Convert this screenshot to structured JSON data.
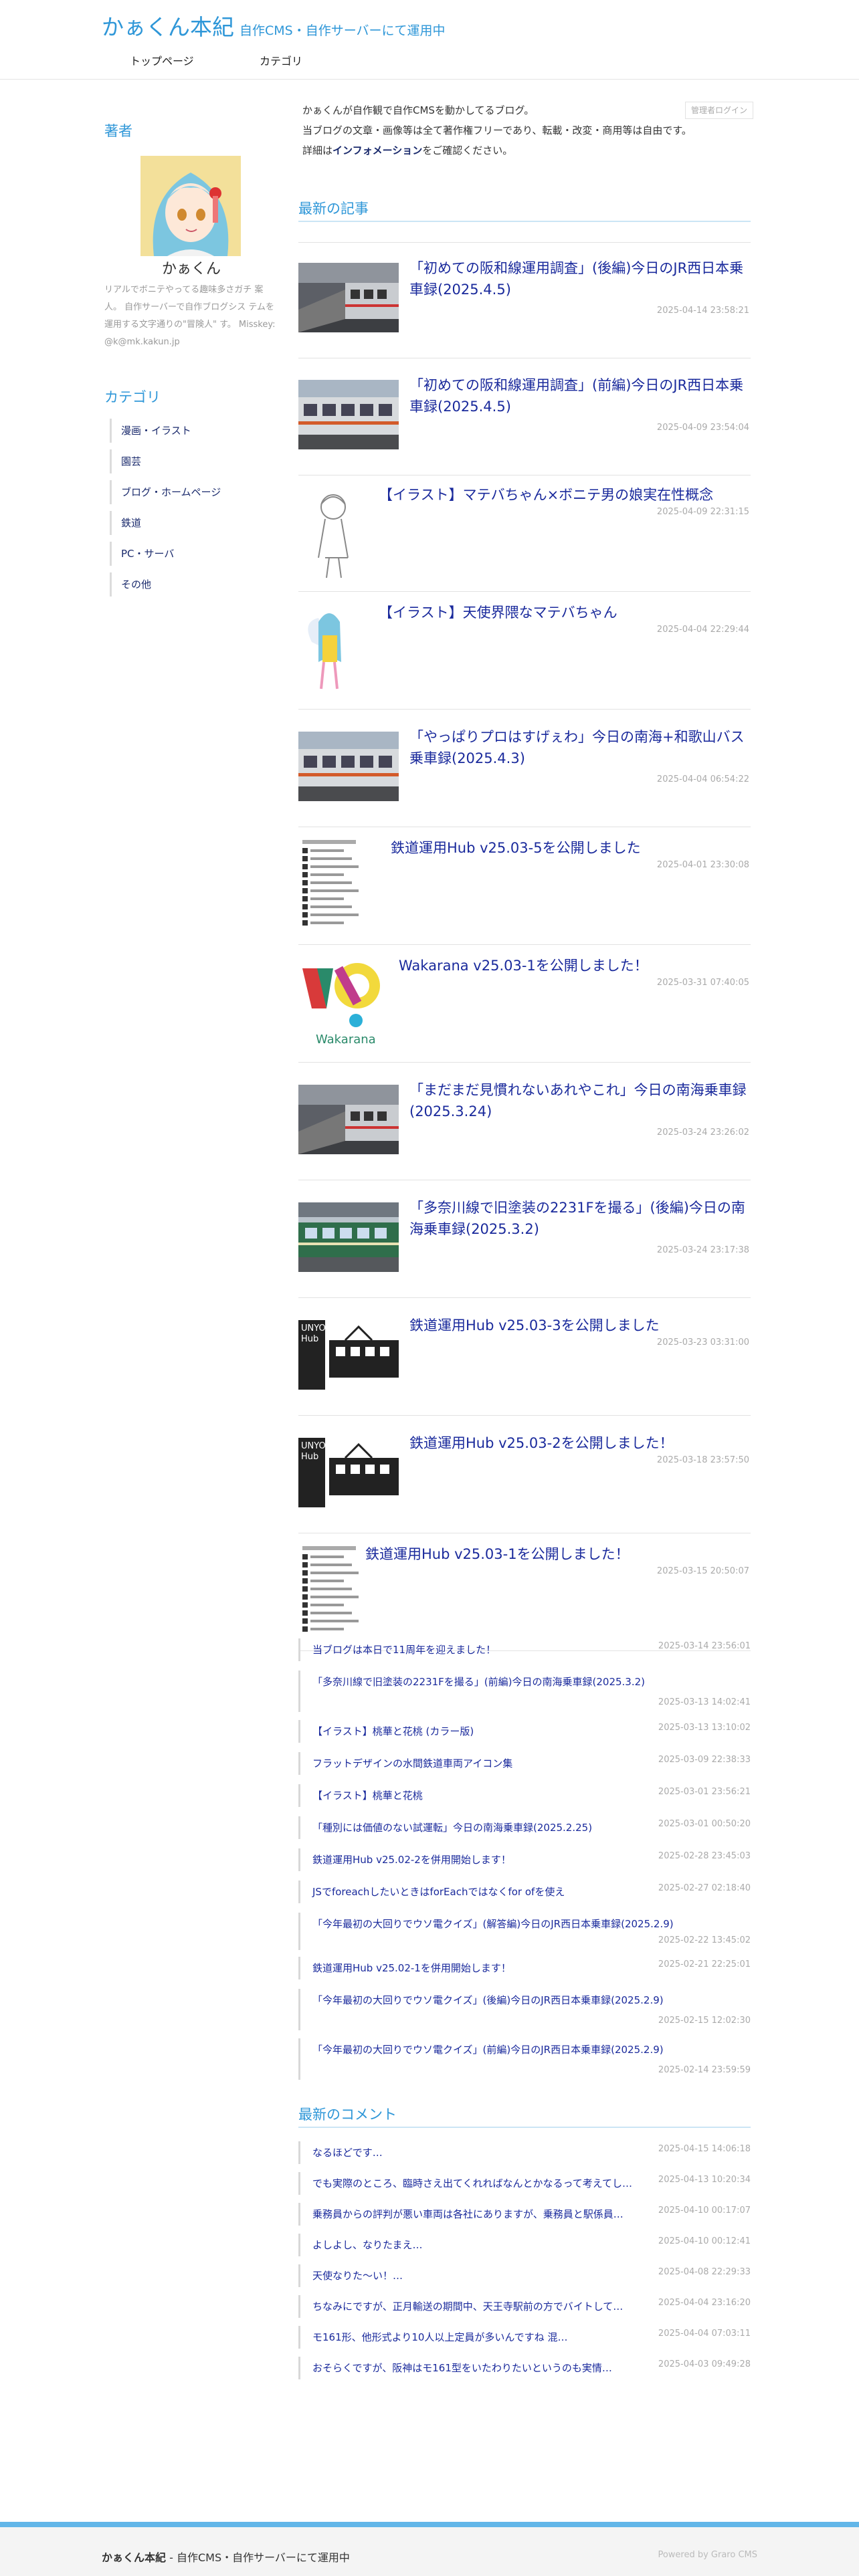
{
  "site": {
    "title": "かぁくん本紀",
    "subtitle": "自作CMS・自作サーバーにて運用中"
  },
  "nav": [
    {
      "label": "トップページ"
    },
    {
      "label": "カテゴリ"
    }
  ],
  "sidebar": {
    "author_heading": "著者",
    "author_name": "かぁくん",
    "author_desc": "リアルでボニテやってる趣味多さガチ 案人。 自作サーバーで自作ブログシス テムを運用する文字通りの\"冒険人\" す。 Misskey: @k@mk.kakun.jp",
    "category_heading": "カテゴリ",
    "categories": [
      {
        "label": "漫画・イラスト"
      },
      {
        "label": "園芸"
      },
      {
        "label": "ブログ・ホームページ"
      },
      {
        "label": "鉄道"
      },
      {
        "label": "PC・サーバ"
      },
      {
        "label": "その他"
      }
    ]
  },
  "intro": {
    "line1": "かぁくんが自作観で自作CMSを動かしてるブログ。",
    "line2": "当ブログの文章・画像等は全て著作権フリーであり、転載・改変・商用等は自由です。",
    "line3_pre": "詳細は",
    "line3_link": "インフォメーション",
    "line3_post": "をご確認ください。",
    "login_label": "管理者ログイン"
  },
  "latest_heading": "最新の記事",
  "articles": [
    {
      "title": "「初めての阪和線運用調査」(後編)今日のJR西日本乗車録(2025.4.5)",
      "date": "2025-04-14 23:58:21",
      "thumb": "train-platform"
    },
    {
      "title": "「初めての阪和線運用調査」(前編)今日のJR西日本乗車録(2025.4.5)",
      "date": "2025-04-09 23:54:04",
      "thumb": "train-side"
    },
    {
      "title": "【イラスト】マテバちゃん×ボニテ男の娘実在性概念",
      "date": "2025-04-09 22:31:15",
      "thumb": "sketch"
    },
    {
      "title": "【イラスト】天使界隈なマテバちゃん",
      "date": "2025-04-04 22:29:44",
      "thumb": "angel"
    },
    {
      "title": "「やっぱりプロはすげぇわ」今日の南海+和歌山バス乗車録(2025.4.3)",
      "date": "2025-04-04 06:54:22",
      "thumb": "train-side"
    },
    {
      "title": "鉄道運用Hub v25.03-5を公開しました",
      "date": "2025-04-01 23:30:08",
      "thumb": "list-shot"
    },
    {
      "title": "Wakarana v25.03-1を公開しました！",
      "date": "2025-03-31 07:40:05",
      "thumb": "wakarana"
    },
    {
      "title": "「まだまだ見慣れないあれやこれ」今日の南海乗車録(2025.3.24)",
      "date": "2025-03-24 23:26:02",
      "thumb": "train-platform"
    },
    {
      "title": "「多奈川線で旧塗装の2231Fを撮る」(後編)今日の南海乗車録(2025.3.2)",
      "date": "2025-03-24 23:17:38",
      "thumb": "train-green"
    },
    {
      "title": "鉄道運用Hub v25.03-3を公開しました",
      "date": "2025-03-23 03:31:00",
      "thumb": "unyo"
    },
    {
      "title": "鉄道運用Hub v25.03-2を公開しました！",
      "date": "2025-03-18 23:57:50",
      "thumb": "unyo"
    },
    {
      "title": "鉄道運用Hub v25.03-1を公開しました！",
      "date": "2025-03-15 20:50:07",
      "thumb": "list-shot"
    }
  ],
  "older_articles": [
    {
      "title": "当ブログは本日で11周年を迎えました！",
      "date": "2025-03-14 23:56:01"
    },
    {
      "title": "「多奈川線で旧塗装の2231Fを撮る」(前編)今日の南海乗車録(2025.3.2)",
      "date": "2025-03-13 14:02:41"
    },
    {
      "title": "【イラスト】桃華と花桃 (カラー版)",
      "date": "2025-03-13 13:10:02"
    },
    {
      "title": "フラットデザインの水間鉄道車両アイコン集",
      "date": "2025-03-09 22:38:33"
    },
    {
      "title": "【イラスト】桃華と花桃",
      "date": "2025-03-01 23:56:21"
    },
    {
      "title": "「種別には価値のない試運転」今日の南海乗車録(2025.2.25)",
      "date": "2025-03-01 00:50:20"
    },
    {
      "title": "鉄道運用Hub v25.02-2を併用開始します！",
      "date": "2025-02-28 23:45:03"
    },
    {
      "title": "JSでforeachしたいときはforEachではなくfor ofを使え",
      "date": "2025-02-27 02:18:40"
    },
    {
      "title": "「今年最初の大回りでウソ電クイズ」(解答編)今日のJR西日本乗車録(2025.2.9)",
      "date": "2025-02-22 13:45:02"
    },
    {
      "title": "鉄道運用Hub v25.02-1を併用開始します！",
      "date": "2025-02-21 22:25:01"
    },
    {
      "title": "「今年最初の大回りでウソ電クイズ」(後編)今日のJR西日本乗車録(2025.2.9)",
      "date": "2025-02-15 12:02:30"
    },
    {
      "title": "「今年最初の大回りでウソ電クイズ」(前編)今日のJR西日本乗車録(2025.2.9)",
      "date": "2025-02-14 23:59:59"
    }
  ],
  "comments_heading": "最新のコメント",
  "comments": [
    {
      "text": "なるほどです…",
      "date": "2025-04-15 14:06:18"
    },
    {
      "text": "でも実際のところ、臨時さえ出てくれればなんとかなるって考えてし…",
      "date": "2025-04-13 10:20:34"
    },
    {
      "text": "乗務員からの評判が悪い車両は各社にありますが、乗務員と駅係員…",
      "date": "2025-04-10 00:17:07"
    },
    {
      "text": "よしよし、なりたまえ…",
      "date": "2025-04-10 00:12:41"
    },
    {
      "text": "天使なりた〜い！…",
      "date": "2025-04-08 22:29:33"
    },
    {
      "text": "ちなみにですが、正月輸送の期間中、天王寺駅前の方でバイトして…",
      "date": "2025-04-04 23:16:20"
    },
    {
      "text": "モ161形、他形式より10人以上定員が多いんですね 混…",
      "date": "2025-04-04 07:03:11"
    },
    {
      "text": "おそらくですが、阪神はモ161型をいたわりたいというのも実情…",
      "date": "2025-04-03 09:49:28"
    }
  ],
  "footer": {
    "site_name": "かぁくん本紀",
    "tagline": " - 自作CMS・自作サーバーにて運用中",
    "powered": "Powered by Graro CMS"
  },
  "colors": {
    "accent": "#2f97d8",
    "link": "#1a2a9c",
    "footer_bar": "#62b6e8"
  }
}
